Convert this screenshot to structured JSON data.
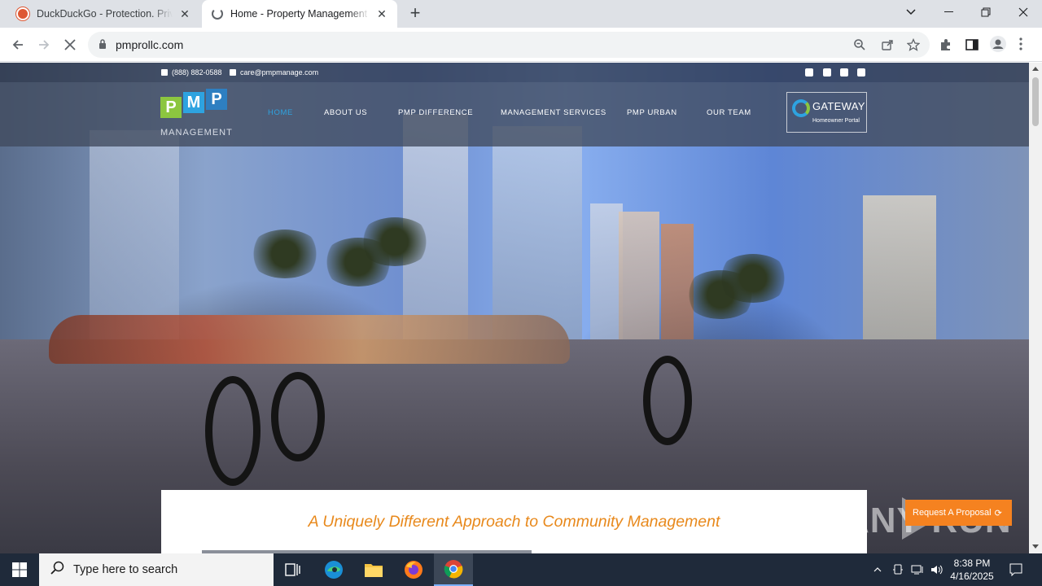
{
  "browser": {
    "tabs": [
      {
        "title": "DuckDuckGo - Protection. Privacy simplified.",
        "active": false,
        "favicon_color": "#de5833"
      },
      {
        "title": "Home - Property Management Professionals",
        "active": true,
        "favicon_color": "#5f6368"
      }
    ],
    "new_tab_label": "+",
    "url": "pmprollc.com"
  },
  "site": {
    "topbar": {
      "phone": "(888) 882-0588",
      "email": "care@pmpmanage.com",
      "social": [
        "twitter-icon",
        "instagram-icon",
        "facebook-icon",
        "linkedin-icon"
      ]
    },
    "logo": {
      "letters": [
        "P",
        "M",
        "P"
      ],
      "word": "MANAGEMENT",
      "tile_colors": [
        "#8cc63f",
        "#2ea3e0",
        "#2e7fc1"
      ]
    },
    "menu": [
      {
        "label": "HOME",
        "active": true
      },
      {
        "label": "ABOUT US",
        "active": false
      },
      {
        "label": "PMP DIFFERENCE",
        "active": false
      },
      {
        "label": "MANAGEMENT SERVICES",
        "active": false
      },
      {
        "label": "PMP URBAN",
        "active": false
      },
      {
        "label": "OUR TEAM",
        "active": false
      }
    ],
    "gateway": {
      "title": "GATEWAY",
      "subtitle": "Homeowner Portal"
    },
    "tagline": "A Uniquely Different Approach to Community Management",
    "proposal_button": "Request A Proposal",
    "watermark": "ANY RUN",
    "accent_orange": "#e8891c",
    "accent_blue": "#2ea3e0"
  },
  "taskbar": {
    "search_placeholder": "Type here to search",
    "time": "8:38 PM",
    "date": "4/16/2025"
  }
}
